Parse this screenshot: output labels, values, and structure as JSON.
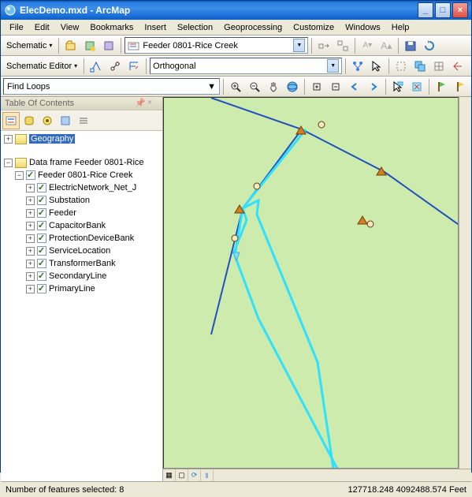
{
  "window": {
    "title": "ElecDemo.mxd - ArcMap"
  },
  "menu": [
    "File",
    "Edit",
    "View",
    "Bookmarks",
    "Insert",
    "Selection",
    "Geoprocessing",
    "Customize",
    "Windows",
    "Help"
  ],
  "toolbar1": {
    "schematic_label": "Schematic",
    "combo_value": "Feeder 0801-Rice Creek"
  },
  "toolbar2": {
    "editor_label": "Schematic Editor",
    "combo_value": "Orthogonal"
  },
  "toolbar3": {
    "input_value": "Find Loops"
  },
  "toc": {
    "title": "Table Of Contents",
    "group1": "Geography",
    "group2": "Data frame Feeder 0801-Rice",
    "layer": "Feeder 0801-Rice Creek",
    "items": [
      "ElectricNetwork_Net_J",
      "Substation",
      "Feeder",
      "CapacitorBank",
      "ProtectionDeviceBank",
      "ServiceLocation",
      "TransformerBank",
      "SecondaryLine",
      "PrimaryLine"
    ]
  },
  "status": {
    "selected": "Number of features selected: 8",
    "coords": "127718.248 4092488.574 Feet"
  }
}
